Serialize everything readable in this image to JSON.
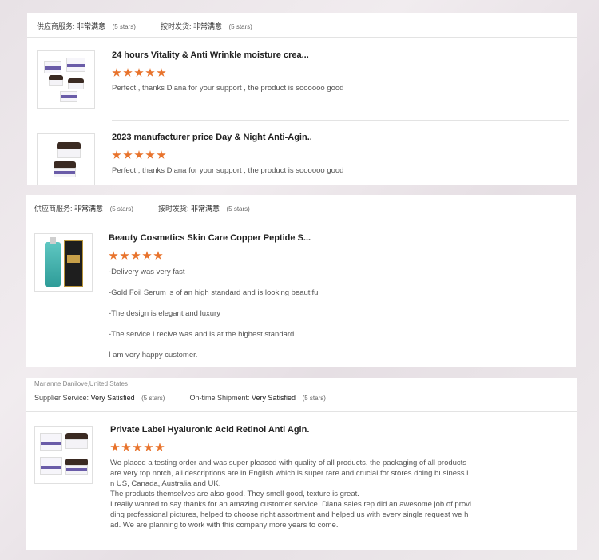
{
  "reviews": [
    {
      "meta": {
        "supplier_label": "供应商服务:",
        "supplier_value": "非常满意",
        "supplier_stars": "(5 stars)",
        "shipment_label": "按时发货:",
        "shipment_value": "非常满意",
        "shipment_stars": "(5 stars)"
      },
      "items": [
        {
          "title": "24 hours Vitality & Anti Wrinkle moisture crea...",
          "rating": 5,
          "text": "Perfect , thanks Diana for your support , the product is soooooo good"
        },
        {
          "title": "2023 manufacturer price Day & Night Anti-Agin...",
          "rating": 5,
          "text": "Perfect , thanks Diana for your support , the product is soooooo good"
        }
      ]
    },
    {
      "meta": {
        "supplier_label": "供应商服务:",
        "supplier_value": "非常满意",
        "supplier_stars": "(5 stars)",
        "shipment_label": "按时发货:",
        "shipment_value": "非常满意",
        "shipment_stars": "(5 stars)"
      },
      "items": [
        {
          "title": "Beauty Cosmetics Skin Care Copper Peptide S...",
          "rating": 5,
          "lines": [
            "-Delivery was very fast",
            "-Gold Foil Serum is of an high standard and is looking beautiful",
            "-The design is elegant and luxury",
            "-The service I recive was and is at the highest standard",
            "I am very happy customer."
          ]
        }
      ]
    },
    {
      "reviewer": "Marianne Danilove,United States",
      "meta": {
        "supplier_label": "Supplier Service:",
        "supplier_value": "Very Satisfied",
        "supplier_stars": "(5 stars)",
        "shipment_label": "On-time Shipment:",
        "shipment_value": "Very Satisfied",
        "shipment_stars": "(5 stars)"
      },
      "items": [
        {
          "title": "Private Label Hyaluronic Acid Retinol Anti Agin...",
          "rating": 5,
          "lines": [
            "We placed a testing order and was super pleased with quality of all products. the packaging of all products",
            "are very top notch, all descriptions are in English which is super rare and crucial for stores doing business i",
            "n US, Canada, Australia and UK.",
            "The products themselves are also good. They smell good, texture is great.",
            "I really wanted to say thanks for an amazing customer service. Diana sales rep did an awesome job of provi",
            "ding professional pictures, helped to choose right assortment and helped us with every single request we h",
            "ad. We are planning to work with this company more years to come."
          ]
        }
      ]
    }
  ],
  "colors": {
    "star": "#e8732c",
    "accent_band": "#6a5ca8"
  }
}
